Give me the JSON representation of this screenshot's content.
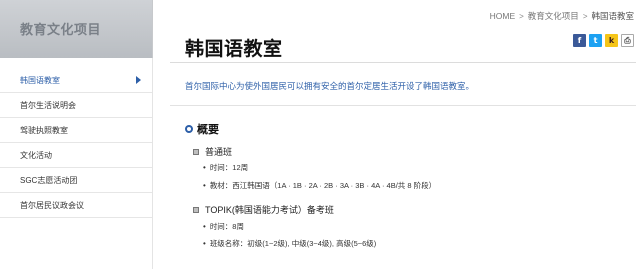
{
  "sidebar": {
    "title": "教育文化项目",
    "items": [
      {
        "label": "韩国语教室",
        "active": true
      },
      {
        "label": "首尔生活说明会",
        "active": false
      },
      {
        "label": "驾驶执照教室",
        "active": false
      },
      {
        "label": "文化活动",
        "active": false
      },
      {
        "label": "SGC志愿活动团",
        "active": false
      },
      {
        "label": "首尔居民议政会议",
        "active": false
      }
    ]
  },
  "breadcrumb": {
    "home": "HOME",
    "sep": ">",
    "level1": "教育文化项目",
    "level2": "韩国语教室"
  },
  "share": {
    "facebook": "f",
    "twitter": "t",
    "kakaostory": "k",
    "print": "⎙"
  },
  "main": {
    "title": "韩国语教室",
    "intro": "首尔国际中心为使外国居民可以拥有安全的首尔定居生活开设了韩国语教室。",
    "section_title": "概要",
    "sub1": {
      "title": "普通班",
      "line1": "时间：12周",
      "line2": "教材：西江韩国语（1A · 1B · 2A · 2B · 3A · 3B · 4A · 4B/共 8 阶段）"
    },
    "sub2": {
      "title": "TOPIK(韩国语能力考试）备考班",
      "line1": "时间：8周",
      "line2": "班级名称：初级(1~2级), 中级(3~4级), 高级(5~6级)"
    }
  },
  "colors": {
    "accent": "#2d5fa8",
    "sidebar_header": "#c3c7cb"
  }
}
